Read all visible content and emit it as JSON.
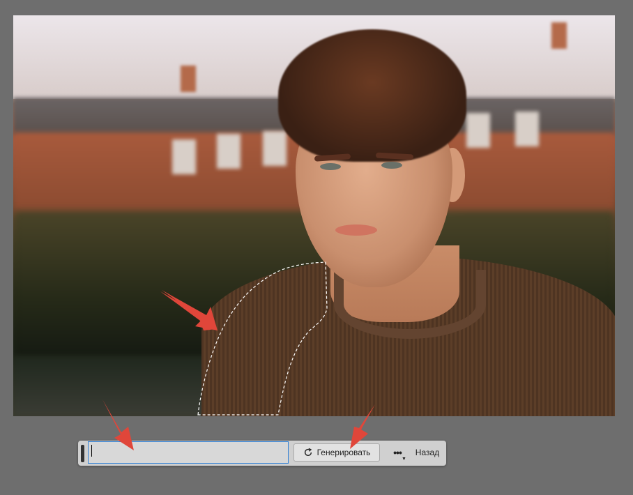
{
  "canvas": {
    "image_alt": "Portrait photo of a young man with curly hair wearing a brown knit sweater, with a dashed selection on the sweater's left shoulder"
  },
  "toolbar": {
    "prompt_value": "",
    "generate_label": "Генерировать",
    "more_label": "•••",
    "back_label": "Назад"
  },
  "icons": {
    "generate": "refresh-icon",
    "grip": "grip-handle-icon",
    "more": "more-options-icon"
  },
  "colors": {
    "workspace_bg": "#6e6e6e",
    "toolbar_bg": "#d0d0d0",
    "input_focus_border": "#2f7fd4",
    "annotation_arrow": "#e0463a"
  }
}
